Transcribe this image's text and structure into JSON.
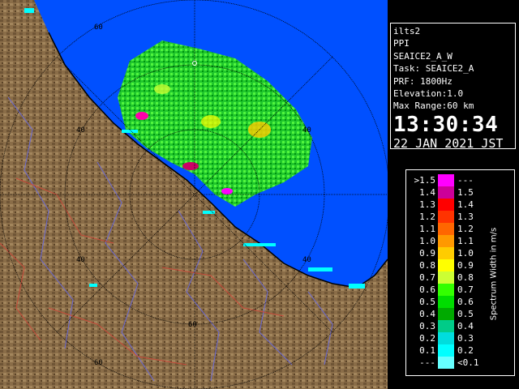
{
  "header": {
    "station": "ilts2",
    "mode": "PPI",
    "product": "SEAICE2_A_W",
    "task": "Task: SEAICE2_A",
    "prf": "PRF: 1800Hz",
    "elevation": "Elevation:1.0",
    "max_range": "Max Range:60 km",
    "time": "13:30:34",
    "date": "22 JAN 2021 JST"
  },
  "map": {
    "range_labels": [
      "60",
      "40",
      "40",
      "40",
      "40",
      "60",
      "60"
    ]
  },
  "legend": {
    "title": "Spectrum Width in m/s",
    "rows": [
      {
        "value": ">1.5",
        "label": "---",
        "color": "#ff00ff"
      },
      {
        "value": "1.4",
        "label": "1.5",
        "color": "#cc0099"
      },
      {
        "value": "1.3",
        "label": "1.4",
        "color": "#ff0000"
      },
      {
        "value": "1.2",
        "label": "1.3",
        "color": "#ff3300"
      },
      {
        "value": "1.1",
        "label": "1.2",
        "color": "#ff6600"
      },
      {
        "value": "1.0",
        "label": "1.1",
        "color": "#ff9900"
      },
      {
        "value": "0.9",
        "label": "1.0",
        "color": "#ffcc00"
      },
      {
        "value": "0.8",
        "label": "0.9",
        "color": "#ffff00"
      },
      {
        "value": "0.7",
        "label": "0.8",
        "color": "#ccff33"
      },
      {
        "value": "0.6",
        "label": "0.7",
        "color": "#33ff00"
      },
      {
        "value": "0.5",
        "label": "0.6",
        "color": "#00dd00"
      },
      {
        "value": "0.4",
        "label": "0.5",
        "color": "#00aa00"
      },
      {
        "value": "0.3",
        "label": "0.4",
        "color": "#00cc88"
      },
      {
        "value": "0.2",
        "label": "0.3",
        "color": "#00dddd"
      },
      {
        "value": "0.1",
        "label": "0.2",
        "color": "#00ffff"
      },
      {
        "value": "---",
        "label": "<0.1",
        "color": "#66ffff"
      }
    ]
  },
  "colors": {
    "land": "#8a6d48",
    "sea": "#0050ff",
    "rings": "#000000"
  }
}
